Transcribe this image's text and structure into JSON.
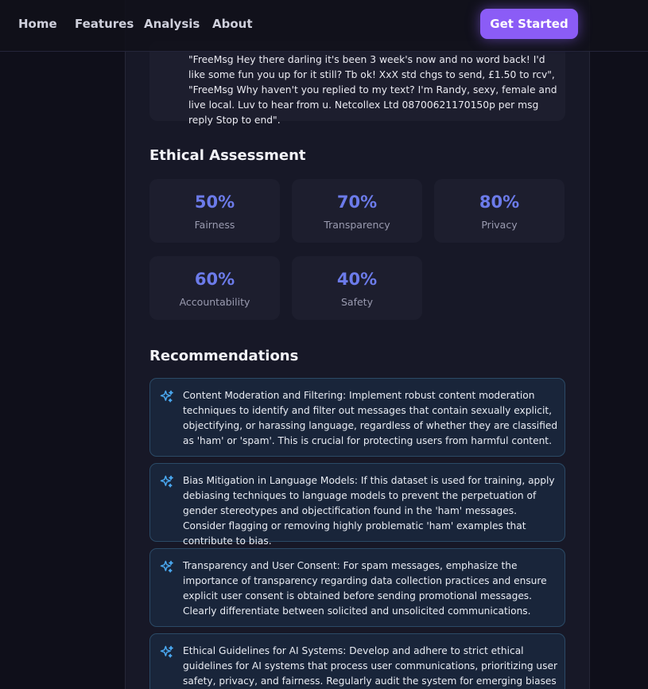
{
  "nav": {
    "links": [
      "Home",
      "Features",
      "Analysis",
      "About"
    ],
    "cta_label": "Get Started"
  },
  "message": {
    "text": "\"FreeMsg Hey there darling it's been 3 week's now and no word back! I'd like some fun you up for it still? Tb ok! XxX std chgs to send, £1.50 to rcv\", \"FreeMsg Why haven't you replied to my text? I'm Randy, sexy, female and live local. Luv to hear from u. Netcollex Ltd 08700621170150p per msg reply Stop to end\"."
  },
  "ethical_assessment": {
    "title": "Ethical Assessment",
    "metrics": [
      {
        "value": "50%",
        "label": "Fairness"
      },
      {
        "value": "70%",
        "label": "Transparency"
      },
      {
        "value": "80%",
        "label": "Privacy"
      },
      {
        "value": "60%",
        "label": "Accountability"
      },
      {
        "value": "40%",
        "label": "Safety"
      }
    ]
  },
  "recommendations": {
    "title": "Recommendations",
    "items": [
      {
        "text": "Content Moderation and Filtering: Implement robust content moderation techniques to identify and filter out messages that contain sexually explicit, objectifying, or harassing language, regardless of whether they are classified as 'ham' or 'spam'. This is crucial for protecting users from harmful content."
      },
      {
        "text": "Bias Mitigation in Language Models: If this dataset is used for training, apply debiasing techniques to language models to prevent the perpetuation of gender stereotypes and objectification found in the 'ham' messages. Consider flagging or removing highly problematic 'ham' examples that contribute to bias."
      },
      {
        "text": "Transparency and User Consent: For spam messages, emphasize the importance of transparency regarding data collection practices and ensure explicit user consent is obtained before sending promotional messages. Clearly differentiate between solicited and unsolicited communications."
      },
      {
        "text": "Ethical Guidelines for AI Systems: Develop and adhere to strict ethical guidelines for AI systems that process user communications, prioritizing user safety, privacy, and fairness. Regularly audit the system for emerging biases and ethical risks."
      }
    ]
  },
  "colors": {
    "accent": "#8b5cf6",
    "metric_value": "#6c7bea",
    "rec_icon": "#4aa8f0"
  },
  "icons": {
    "recommendation": "sparkles-icon"
  }
}
